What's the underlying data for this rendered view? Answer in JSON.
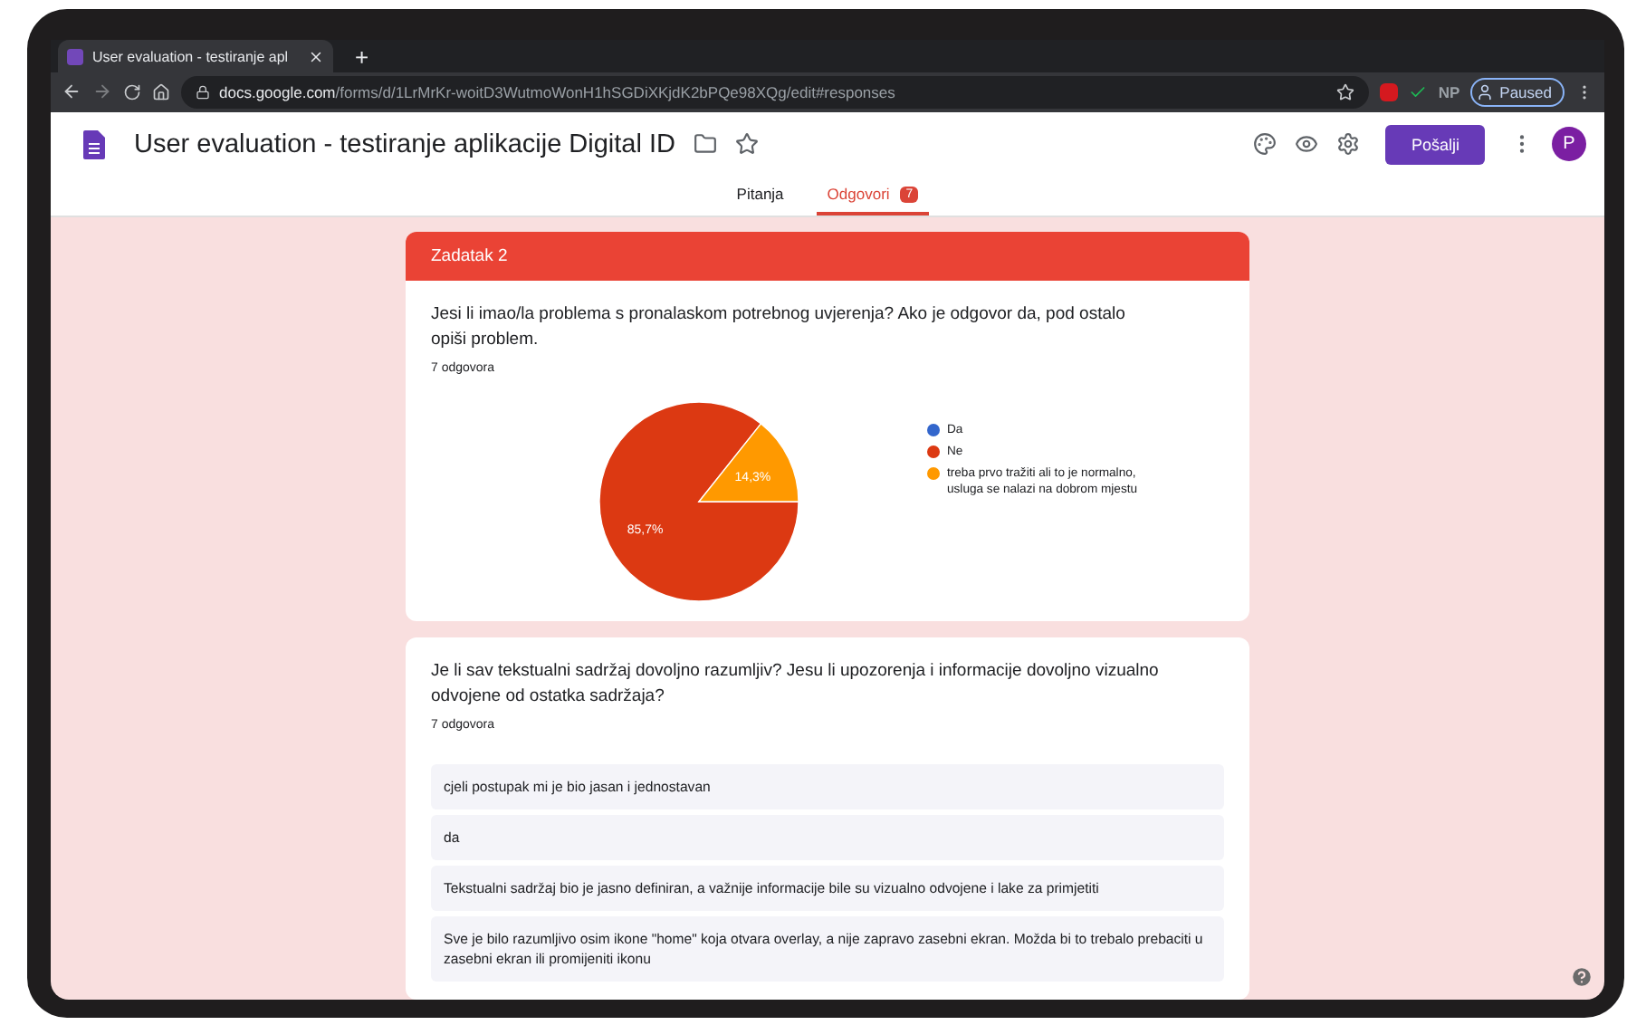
{
  "browser": {
    "tab_title": "User evaluation - testiranje apl",
    "new_tab": "+",
    "url_domain": "docs.google.com",
    "url_path": "/forms/d/1LrMrKr-woitD3WutmoWonH1hSGDiXKjdK2bPQe98XQg/edit#responses",
    "extension_text": "NP",
    "profile": "Paused"
  },
  "app": {
    "title": "User evaluation - testiranje aplikacije Digital ID",
    "send_button": "Pošalji",
    "avatar": "P"
  },
  "tabs": [
    {
      "label": "Pitanja",
      "selected": false
    },
    {
      "label": "Odgovori",
      "selected": true,
      "badge": "7"
    }
  ],
  "cards": [
    {
      "kind": "chart",
      "header": "Zadatak 2",
      "question": "Jesi li imao/la problema s pronalaskom potrebnog uvjerenja? Ako je odgovor da, pod ostalo opiši problem.",
      "count": "7 odgovora",
      "chart_data": {
        "type": "pie",
        "categories": [
          "Da",
          "Ne",
          "treba prvo tražiti ali to je normalno, usluga se nalazi na dobrom mjestu"
        ],
        "values": [
          0,
          85.7,
          14.3
        ],
        "colors": [
          "#3366cc",
          "#dc3912",
          "#ff9900"
        ],
        "value_labels": [
          null,
          "85,7%",
          "14,3%"
        ],
        "legend": "right"
      }
    },
    {
      "kind": "text",
      "question": "Je li sav tekstualni sadržaj dovoljno razumljiv? Jesu li upozorenja i informacije dovoljno vizualno odvojene od ostatka sadržaja?",
      "count": "7 odgovora",
      "responses": [
        "cjeli postupak mi je bio jasan i jednostavan",
        "da",
        "Tekstualni sadržaj bio je jasno definiran, a važnije informacije bile su vizualno odvojene i lake za primjetiti",
        "Sve je bilo razumljivo osim ikone \"home\" koja otvara overlay, a nije zapravo zasebni ekran. Možda bi to trebalo prebaciti u zasebni ekran ili promijeniti ikonu"
      ]
    }
  ]
}
